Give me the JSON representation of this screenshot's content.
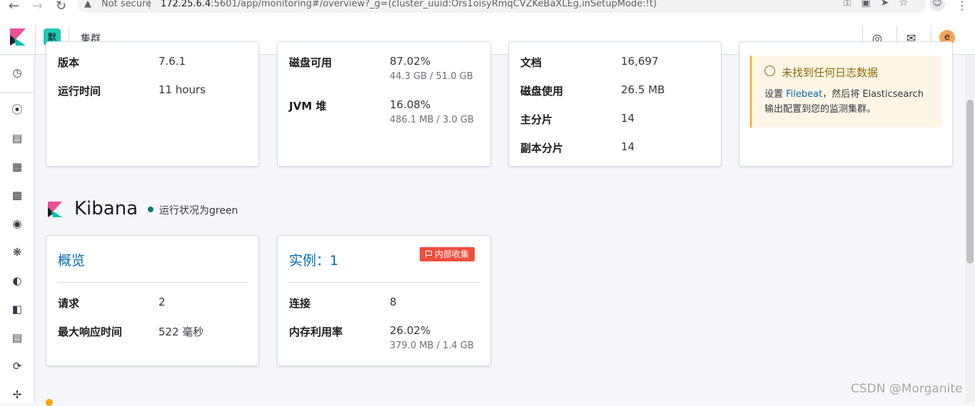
{
  "browser": {
    "warning_label": "Not secure",
    "separator": "|",
    "url_host": "172.25.6.4",
    "url_rest": ":5601/app/monitoring#/overview?_g=(cluster_uuid:Ors1oisyRmqCVZKeBaXLEg,inSetupMode:!t)",
    "profile_glyph": "☺"
  },
  "header": {
    "space_badge": "默",
    "breadcrumb": "集群",
    "avatar_letter": "e"
  },
  "es_overview": {
    "version_label": "版本",
    "version_value": "7.6.1",
    "uptime_label": "运行时间",
    "uptime_value": "11 hours"
  },
  "es_nodes": {
    "disk_label": "磁盘可用",
    "disk_value": "87.02%",
    "disk_sub": "44.3 GB / 51.0 GB",
    "jvm_label": "JVM 堆",
    "jvm_value": "16.08%",
    "jvm_sub": "486.1 MB / 3.0 GB"
  },
  "es_indices": {
    "docs_label": "文档",
    "docs_value": "16,697",
    "disk_usage_label": "磁盘使用",
    "disk_usage_value": "26.5 MB",
    "primary_label": "主分片",
    "primary_value": "14",
    "replica_label": "副本分片",
    "replica_value": "14"
  },
  "logs_callout": {
    "title": "未找到任何日志数据",
    "body_prefix": "设置 ",
    "body_link": "Filebeat",
    "body_suffix_line1": "，然后将 Elasticsearch",
    "body_line2": "输出配置到您的监测集群。"
  },
  "kibana": {
    "title": "Kibana",
    "status": "运行状况为green",
    "overview_title": "概览",
    "requests_label": "请求",
    "requests_value": "2",
    "max_resp_label": "最大响应时间",
    "max_resp_value": "522 毫秒",
    "instances_title": "实例：1",
    "collect_badge": "内部收集",
    "connections_label": "连接",
    "connections_value": "8",
    "memory_label": "内存利用率",
    "memory_value": "26.02%",
    "memory_sub": "379.0 MB / 1.4 GB"
  },
  "watermark": "CSDN @Morganite",
  "colors": {
    "link": "#006bb4",
    "healthy": "#017d73",
    "warning": "#f5a700",
    "danger": "#f04e3e",
    "space": "#20c9b8"
  }
}
